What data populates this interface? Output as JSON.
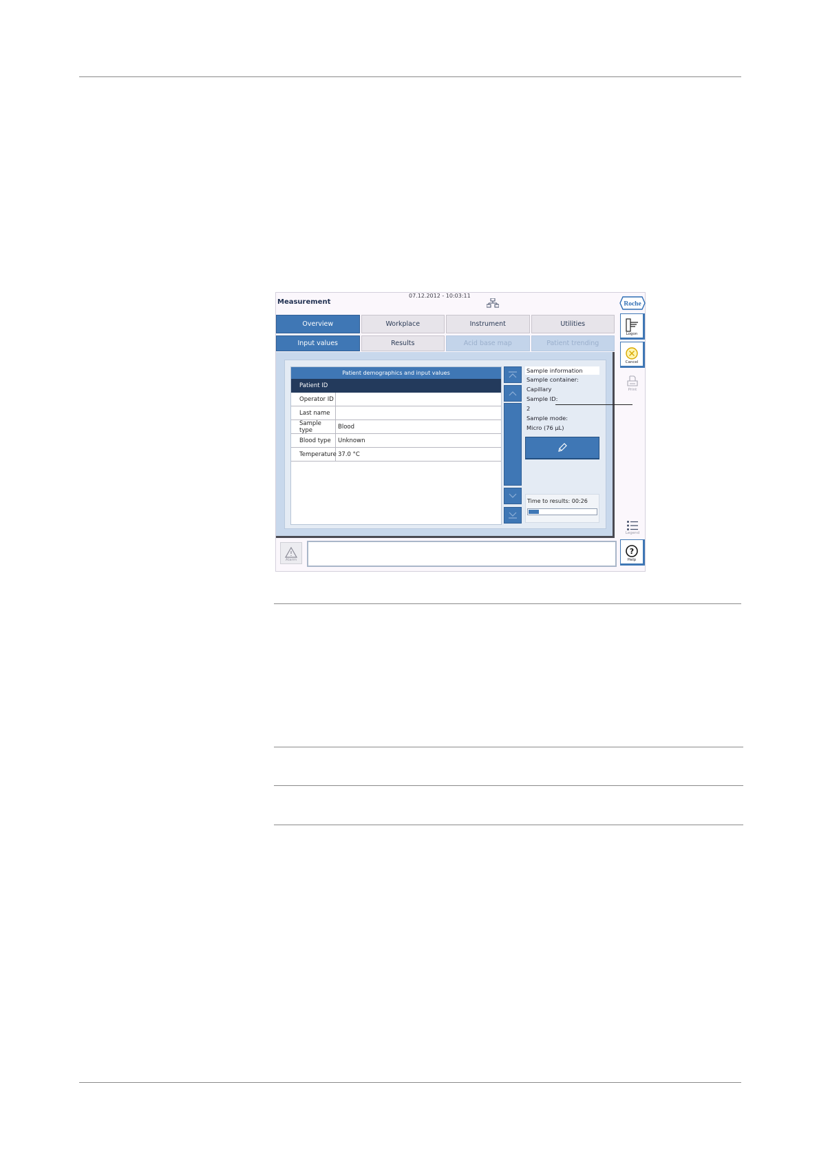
{
  "screen": {
    "title": "Measurement",
    "datetime": "07.12.2012 - 10:03:11",
    "logo": "Roche",
    "main_tabs": [
      "Overview",
      "Workplace",
      "Instrument",
      "Utilities"
    ],
    "sub_tabs": [
      "Input values",
      "Results",
      "Acid base map",
      "Patient trending"
    ],
    "patient_table": {
      "header": "Patient demographics and input values",
      "rows": [
        {
          "label": "Patient ID",
          "value": ""
        },
        {
          "label": "Operator ID",
          "value": ""
        },
        {
          "label": "Last name",
          "value": ""
        },
        {
          "label": "Sample type",
          "value": "Blood"
        },
        {
          "label": "Blood type",
          "value": "Unknown"
        },
        {
          "label": "Temperature",
          "value": "37.0 °C"
        }
      ]
    },
    "sample_info": {
      "header": "Sample information",
      "container_label": "Sample container:",
      "container_value": "Capillary",
      "id_label": "Sample ID:",
      "id_value": "2",
      "mode_label": "Sample mode:",
      "mode_value": "Micro (76 µL)"
    },
    "time_to_results": "Time to results: 00:26",
    "progress": 0.15,
    "side_buttons": {
      "logon": "Logon",
      "cancel": "Cancel",
      "print": "Print",
      "legend": "Legend",
      "help": "Help"
    },
    "alarm": "Alarm"
  },
  "colors": {
    "accent": "#3f77b5",
    "selected_row": "#233a5c",
    "disabled_tab": "#c3d4ea"
  }
}
